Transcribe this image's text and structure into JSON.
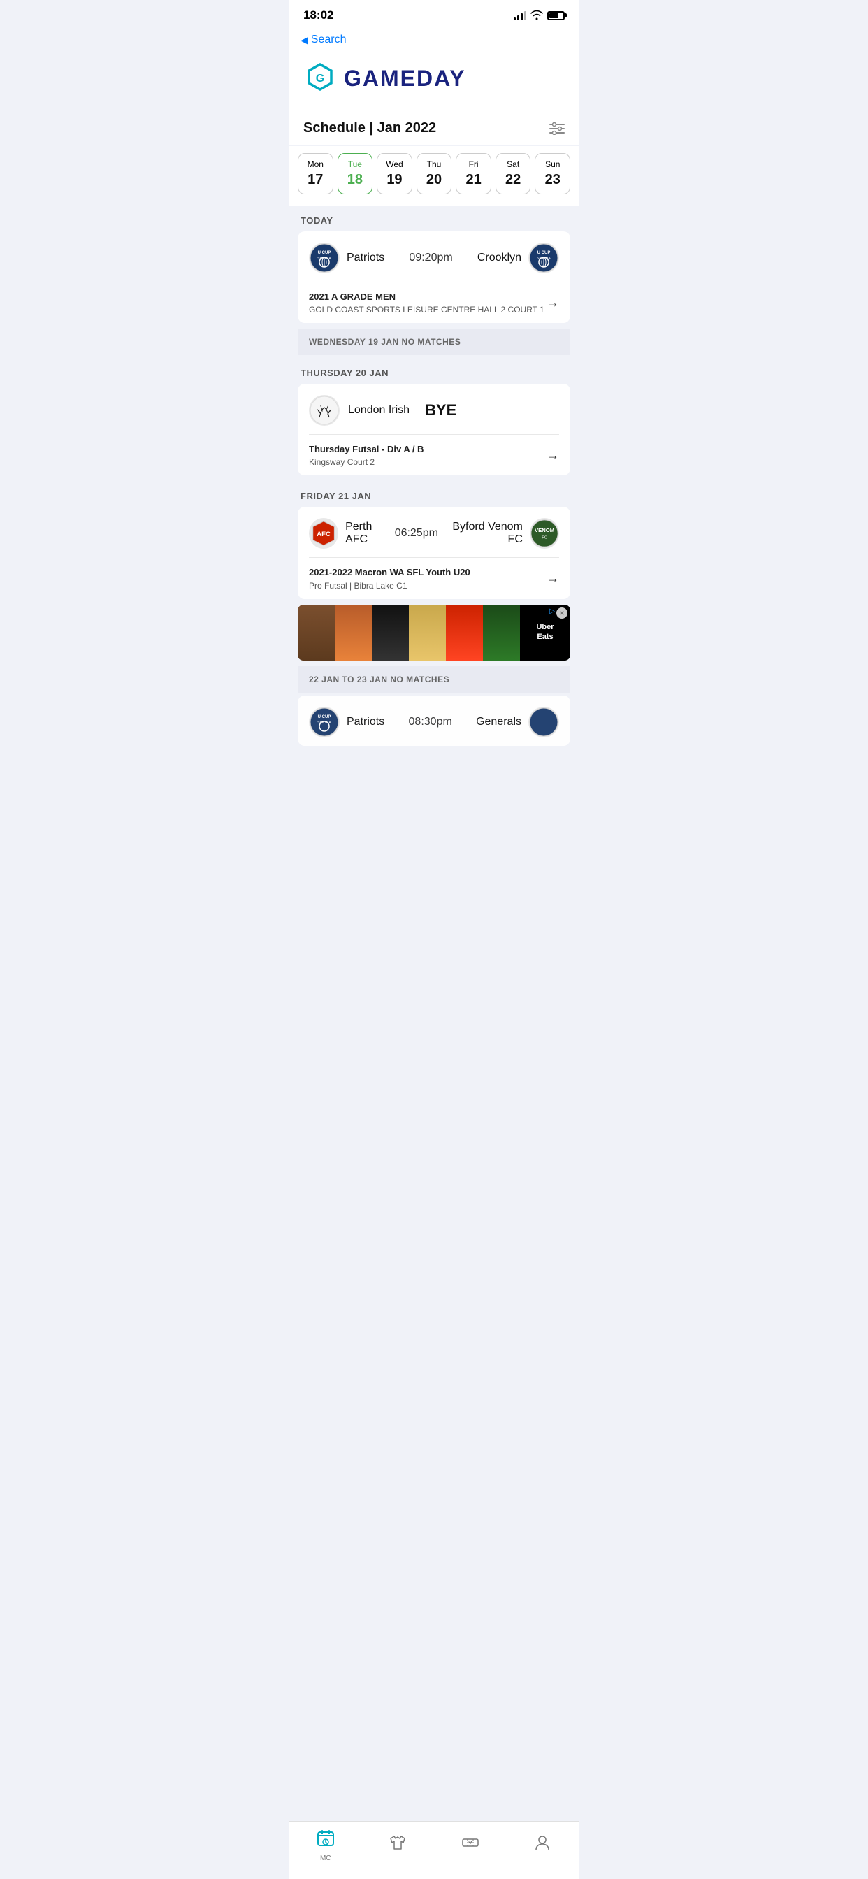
{
  "statusBar": {
    "time": "18:02",
    "signalBars": [
      3,
      5,
      7,
      10
    ],
    "batteryLevel": 60
  },
  "nav": {
    "backLabel": "Search"
  },
  "header": {
    "logoText": "GAMEDAY"
  },
  "schedule": {
    "title": "Schedule",
    "period": "Jan 2022",
    "filterIconLabel": "filter-icon"
  },
  "calendarDays": [
    {
      "name": "Mon",
      "num": "17",
      "active": false
    },
    {
      "name": "Tue",
      "num": "18",
      "active": true
    },
    {
      "name": "Wed",
      "num": "19",
      "active": false
    },
    {
      "name": "Thu",
      "num": "20",
      "active": false
    },
    {
      "name": "Fri",
      "num": "21",
      "active": false
    },
    {
      "name": "Sat",
      "num": "22",
      "active": false
    },
    {
      "name": "Sun",
      "num": "23",
      "active": false
    }
  ],
  "sections": {
    "today": "Today",
    "wednesday": "WEDNESDAY 19 JAN NO MATCHES",
    "thursday": "THURSDAY 20 JAN",
    "friday": "FRIDAY 21 JAN",
    "noMatches": "22 JAN to 23 JAN NO MATCHES"
  },
  "matches": {
    "todayMatch": {
      "teamLeft": "Patriots",
      "time": "09:20pm",
      "teamRight": "Crooklyn",
      "competition": "2021 A GRADE MEN",
      "venue": "GOLD COAST SPORTS LEISURE CENTRE HALL 2 COURT 1"
    },
    "thursdayMatch": {
      "teamLeft": "London Irish",
      "bye": "BYE",
      "competition": "Thursday Futsal - Div A / B",
      "venue": "Kingsway Court 2"
    },
    "fridayMatch": {
      "teamLeft": "Perth AFC",
      "time": "06:25pm",
      "teamRight": "Byford Venom FC",
      "competition": "2021-2022 Macron WA SFL Youth U20",
      "venue": "Pro Futsal | Bibra Lake C1"
    },
    "peekMatch": {
      "teamLeft": "Patriots",
      "time": "08:30pm",
      "teamRight": "Generals"
    }
  },
  "ad": {
    "brandName": "Uber",
    "brandLine2": "Eats",
    "closeLabel": "×"
  },
  "bottomNav": {
    "items": [
      {
        "label": "MC",
        "icon": "calendar-icon",
        "active": true
      },
      {
        "label": "",
        "icon": "jersey-icon",
        "active": false
      },
      {
        "label": "",
        "icon": "ticket-icon",
        "active": false
      },
      {
        "label": "",
        "icon": "profile-icon",
        "active": false
      }
    ]
  }
}
